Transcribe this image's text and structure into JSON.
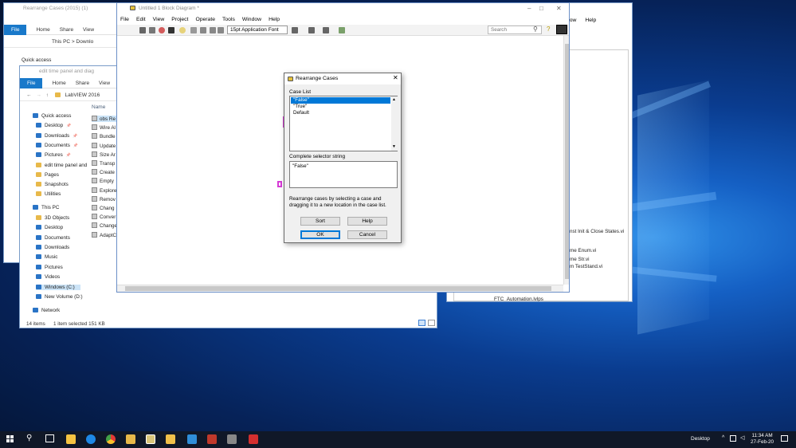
{
  "explorer_back": {
    "title": "Rearrange Cases (2015) (1)",
    "ribbon": [
      "File",
      "Home",
      "Share",
      "View"
    ],
    "path": [
      "This PC",
      "Downlo"
    ],
    "nav": [
      "Quick access"
    ]
  },
  "explorer_front": {
    "title": "edit time panel and diag",
    "ribbon": [
      "File",
      "Home",
      "Share",
      "View"
    ],
    "path": [
      "LabVIEW 2016"
    ],
    "column_header": "Name",
    "nav": [
      {
        "label": "Quick access",
        "icon": "star-icon"
      },
      {
        "label": "Desktop",
        "icon": "desktop-icon",
        "pinned": true
      },
      {
        "label": "Downloads",
        "icon": "download-icon",
        "pinned": true
      },
      {
        "label": "Documents",
        "icon": "documents-icon",
        "pinned": true
      },
      {
        "label": "Pictures",
        "icon": "pictures-icon",
        "pinned": true
      },
      {
        "label": "edit time panel and",
        "icon": "folder-icon"
      },
      {
        "label": "Pages",
        "icon": "folder-icon"
      },
      {
        "label": "Snapshots",
        "icon": "folder-icon"
      },
      {
        "label": "Utilities",
        "icon": "folder-icon"
      },
      {
        "label": "This PC",
        "icon": "pc-icon"
      },
      {
        "label": "3D Objects",
        "icon": "folder-icon"
      },
      {
        "label": "Desktop",
        "icon": "desktop-icon"
      },
      {
        "label": "Documents",
        "icon": "documents-icon"
      },
      {
        "label": "Downloads",
        "icon": "download-icon"
      },
      {
        "label": "Music",
        "icon": "music-icon"
      },
      {
        "label": "Pictures",
        "icon": "pictures-icon"
      },
      {
        "label": "Videos",
        "icon": "videos-icon"
      },
      {
        "label": "Windows (C:)",
        "icon": "drive-icon"
      },
      {
        "label": "New Volume (D:)",
        "icon": "drive-icon"
      },
      {
        "label": "Network",
        "icon": "network-icon"
      }
    ],
    "files": [
      "obs Re",
      "Wire Al",
      "Bundle",
      "Update",
      "Size Ar",
      "Transp",
      "Create",
      "Empty",
      "Explore",
      "Remov",
      "Chang",
      "Conver",
      "Change",
      "AdaptC"
    ],
    "status_items": "14 items",
    "status_selected": "1 item selected  151 KB"
  },
  "labview": {
    "title": "Untitled 1 Block Diagram *",
    "menu": [
      "File",
      "Edit",
      "View",
      "Project",
      "Operate",
      "Tools",
      "Window",
      "Help"
    ],
    "font_select": "15pt Application Font",
    "search_placeholder": "Search"
  },
  "back_window_right": {
    "menu": [
      "dow",
      "Help"
    ],
    "items": [
      "nst Init & Close States.vi",
      "me Enum.vi",
      "me Str.vi",
      "m TestStand.vi",
      "FTC_Automation.lvlps"
    ]
  },
  "dialog": {
    "title": "Rearrange Cases",
    "case_list_label": "Case List",
    "cases": [
      "\"False\"",
      "\"True\"",
      "Default"
    ],
    "selected_case_index": 0,
    "selector_label": "Complete selector string",
    "selector_value": "\"False\"",
    "hint": "Rearrange cases by selecting a case and dragging it to a new location in the case list.",
    "sort_label": "Sort",
    "help_label": "Help",
    "ok_label": "OK",
    "cancel_label": "Cancel"
  },
  "taskbar": {
    "desktop_label": "Desktop",
    "time": "11:34 AM",
    "date": "27-Feb-20"
  }
}
